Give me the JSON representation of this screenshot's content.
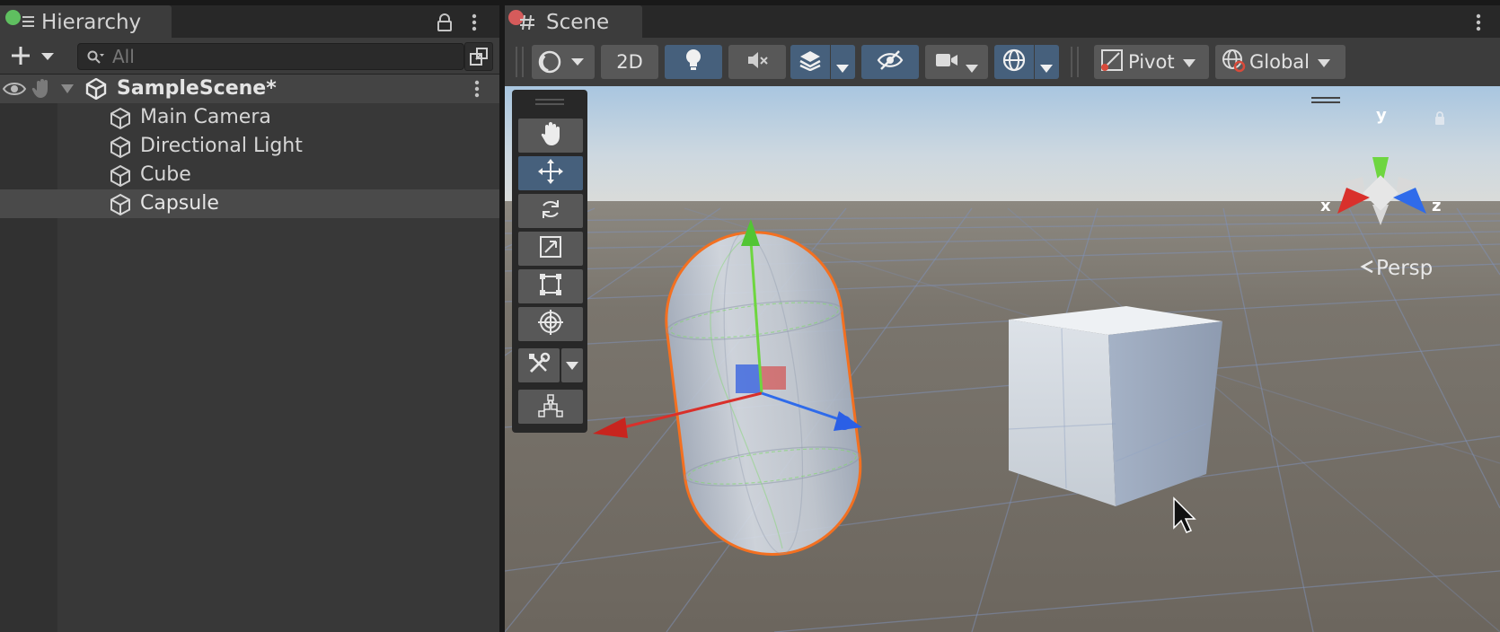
{
  "hierarchy": {
    "tab_title": "Hierarchy",
    "search_placeholder": "All",
    "scene_name": "SampleScene*",
    "items": [
      {
        "label": "Main Camera"
      },
      {
        "label": "Directional Light"
      },
      {
        "label": "Cube"
      },
      {
        "label": "Capsule"
      }
    ]
  },
  "scene": {
    "tab_title": "Scene",
    "toolbar": {
      "mode_2d_label": "2D",
      "pivot_label": "Pivot",
      "global_label": "Global"
    },
    "gizmo": {
      "x_label": "x",
      "y_label": "y",
      "z_label": "z",
      "projection_label": "Persp"
    }
  },
  "colors": {
    "accent_active": "#46607c",
    "selection_outline": "#f37021",
    "axis_x": "#d9302b",
    "axis_y": "#6ed640",
    "axis_z": "#2f6bea"
  }
}
